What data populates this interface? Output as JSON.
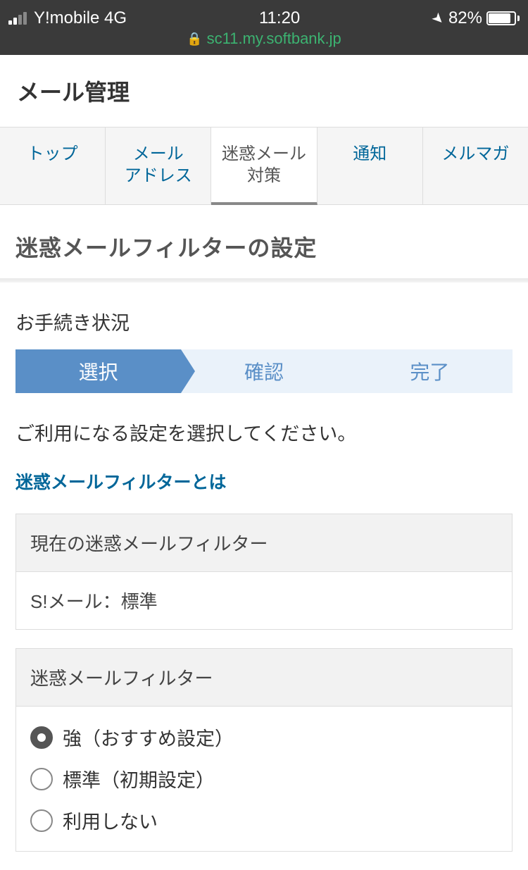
{
  "statusBar": {
    "carrier": "Y!mobile 4G",
    "time": "11:20",
    "batteryPercent": "82%",
    "url": "sc11.my.softbank.jp"
  },
  "header": {
    "title": "メール管理"
  },
  "tabs": [
    {
      "label": "トップ"
    },
    {
      "label": "メール\nアドレス"
    },
    {
      "label": "迷惑メール\n対策"
    },
    {
      "label": "通知"
    },
    {
      "label": "メルマガ"
    }
  ],
  "sectionTitle": "迷惑メールフィルターの設定",
  "progressLabel": "お手続き状況",
  "steps": [
    "選択",
    "確認",
    "完了"
  ],
  "instruction": "ご利用になる設定を選択してください。",
  "filterInfoLink": "迷惑メールフィルターとは",
  "currentFilter": {
    "header": "現在の迷惑メールフィルター",
    "value": "S!メール：標準"
  },
  "filterOptions": {
    "header": "迷惑メールフィルター",
    "options": [
      {
        "label": "強（おすすめ設定）",
        "selected": true
      },
      {
        "label": "標準（初期設定）",
        "selected": false
      },
      {
        "label": "利用しない",
        "selected": false
      }
    ]
  }
}
